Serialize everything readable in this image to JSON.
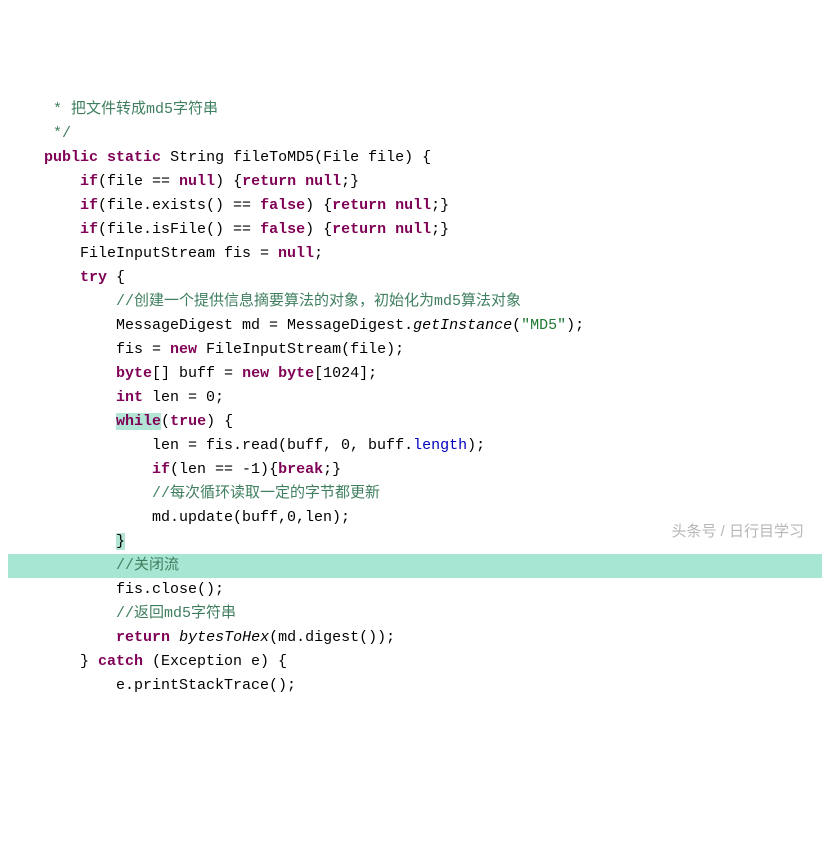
{
  "code": {
    "c1a": "     * ",
    "c1b": "把文件转成md5字符串",
    "c2": "     */",
    "l3_kw1": "public",
    "l3_kw2": "static",
    "l3_a": " String fileToMD5(File file) {",
    "l4_a": "        ",
    "l4_kw": "if",
    "l4_b": "(file == ",
    "l4_c": ") {",
    "l4_d": ";}",
    "l5_a": "        ",
    "l5_kw": "if",
    "l5_b": "(file.exists() == ",
    "l5_false": "false",
    "l5_c": ") {",
    "l5_d": ";}",
    "l6_a": "        ",
    "l6_kw": "if",
    "l6_b": "(file.isFile() == ",
    "l6_c": ") {",
    "l6_d": ";}",
    "ret": "return",
    "null": "null",
    "l7_a": "        FileInputStream fis = ",
    "l7_b": ";",
    "l8_a": "        ",
    "l8_kw": "try",
    "l8_b": " {",
    "c9": "            //创建一个提供信息摘要算法的对象，初始化为md5算法对象",
    "l10_a": "            MessageDigest md = MessageDigest.",
    "l10_gi": "getInstance",
    "l10_b": "(",
    "l10_str": "\"MD5\"",
    "l10_c": ");",
    "l11_a": "            fis = ",
    "l11_kw": "new",
    "l11_b": " FileInputStream(file);",
    "l12_a": "            ",
    "l12_kw1": "byte",
    "l12_b": "[] buff = ",
    "l12_kw2": "new",
    "l12_c": " ",
    "l12_kw3": "byte",
    "l12_d": "[1024];",
    "l13_a": "            ",
    "l13_kw": "int",
    "l13_b": " len = 0;",
    "l14_a": "            ",
    "l14_kw": "while",
    "l14_b": "(",
    "l14_true": "true",
    "l14_c": ") {",
    "l15_a": "                len = fis.read(buff, 0, buff.",
    "l15_len": "length",
    "l15_b": ");",
    "l16_a": "                ",
    "l16_kw": "if",
    "l16_b": "(len == -1){",
    "l16_brk": "break",
    "l16_c": ";}",
    "c17": "                //每次循环读取一定的字节都更新",
    "l18": "                md.update(buff,0,len);",
    "l19_a": "            ",
    "l19_b": "}",
    "c20_a": "            ",
    "c20_b": "//关闭流",
    "l21": "            fis.close();",
    "c22": "            //返回md5字符串",
    "l23_a": "            ",
    "l23_kw": "return",
    "l23_b": " ",
    "l23_fn": "bytesToHex",
    "l23_c": "(md.digest());",
    "l24_a": "        } ",
    "l24_kw": "catch",
    "l24_b": " (Exception e) {",
    "l25": "            e.printStackTrace();"
  },
  "watermark": "头条号 / 日行目学习"
}
